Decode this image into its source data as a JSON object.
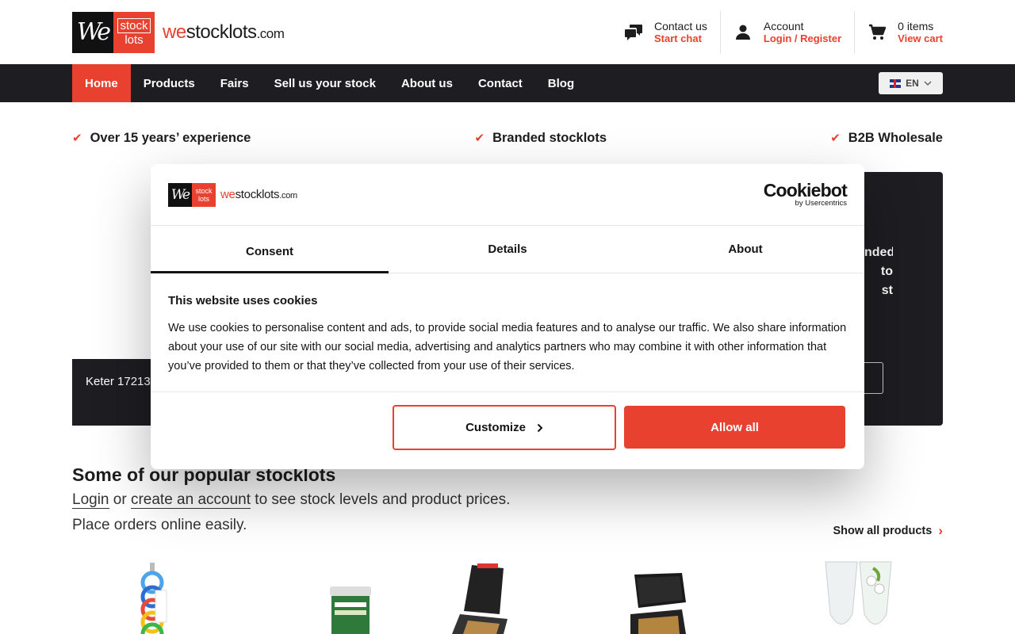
{
  "brand": {
    "logo_we": "We",
    "logo_stock": "stock",
    "logo_lots": "lots",
    "logo_text_we": "we",
    "logo_text_stocklots": "stocklots",
    "logo_text_com": ".com"
  },
  "header": {
    "contact": {
      "label": "Contact us",
      "link": "Start chat",
      "icon": "chat-icon"
    },
    "account": {
      "label": "Account",
      "link": "Login / Register",
      "icon": "user-icon"
    },
    "cart": {
      "label": "0 items",
      "link": "View cart",
      "icon": "cart-icon"
    }
  },
  "nav": {
    "items": [
      "Home",
      "Products",
      "Fairs",
      "Sell us your stock",
      "About us",
      "Contact",
      "Blog"
    ],
    "active": "Home",
    "language": "EN"
  },
  "usps": [
    "Over 15 years’ experience",
    "Branded stocklots",
    "B2B Wholesale"
  ],
  "hero": {
    "caption_partial": "Keter 17213",
    "right_text_partial": "nded\nto\nst",
    "right_button_partial": "n"
  },
  "popular": {
    "title": "Some of our popular stocklots",
    "login": "Login",
    "or": "or",
    "create_account": "create an account",
    "rest": "to see stock levels and product prices. Place orders online easily.",
    "show_all": "Show all products"
  },
  "cookie_modal": {
    "provider": "Cookiebot",
    "provider_sub": "by Usercentrics",
    "tabs": [
      "Consent",
      "Details",
      "About"
    ],
    "active_tab": "Consent",
    "heading": "This website uses cookies",
    "body": "We use cookies to personalise content and ads, to provide social media features and to analyse our traffic. We also share information about your use of our site with our social media, advertising and analytics partners who may combine it with other information that you’ve provided to them or that they’ve collected from your use of their services.",
    "customize": "Customize",
    "allow_all": "Allow all"
  },
  "colors": {
    "accent": "#e8412f",
    "dark": "#1d1d22"
  }
}
